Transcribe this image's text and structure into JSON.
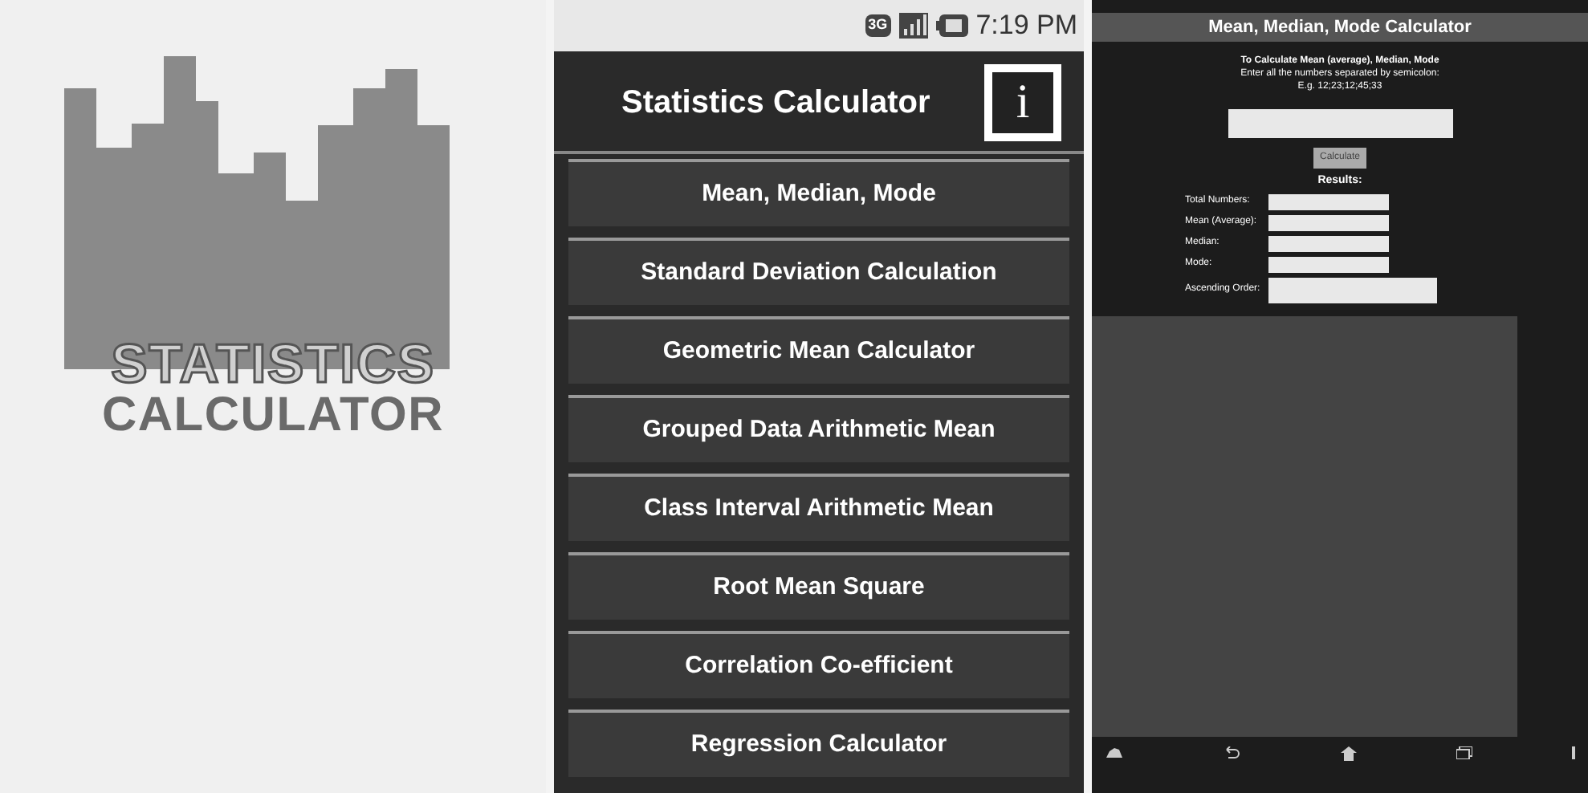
{
  "splash": {
    "logo_line_1": "STATISTICS",
    "logo_line_2": "CALCULATOR"
  },
  "phone": {
    "status_bar": {
      "network": "3G",
      "time": "7:19 PM"
    },
    "title": "Statistics Calculator",
    "info_button": "i",
    "menu": [
      "Mean, Median, Mode",
      "Standard Deviation Calculation",
      "Geometric Mean Calculator",
      "Grouped Data Arithmetic Mean",
      "Class Interval Arithmetic Mean",
      "Root Mean Square",
      "Correlation Co-efficient",
      "Regression Calculator"
    ]
  },
  "tablet": {
    "title": "Mean, Median, Mode Calculator",
    "instructions": [
      "To Calculate Mean (average), Median, Mode",
      "Enter all the numbers separated by semicolon:",
      "E.g. 12;23;12;45;33"
    ],
    "calculate_button": "Calculate",
    "results_heading": "Results:",
    "results": [
      {
        "label": "Total Numbers:",
        "kind": "short"
      },
      {
        "label": "Mean (Average):",
        "kind": "short"
      },
      {
        "label": "Median:",
        "kind": "short"
      },
      {
        "label": "Mode:",
        "kind": "short"
      },
      {
        "label": "Ascending Order:",
        "kind": "long"
      }
    ]
  }
}
